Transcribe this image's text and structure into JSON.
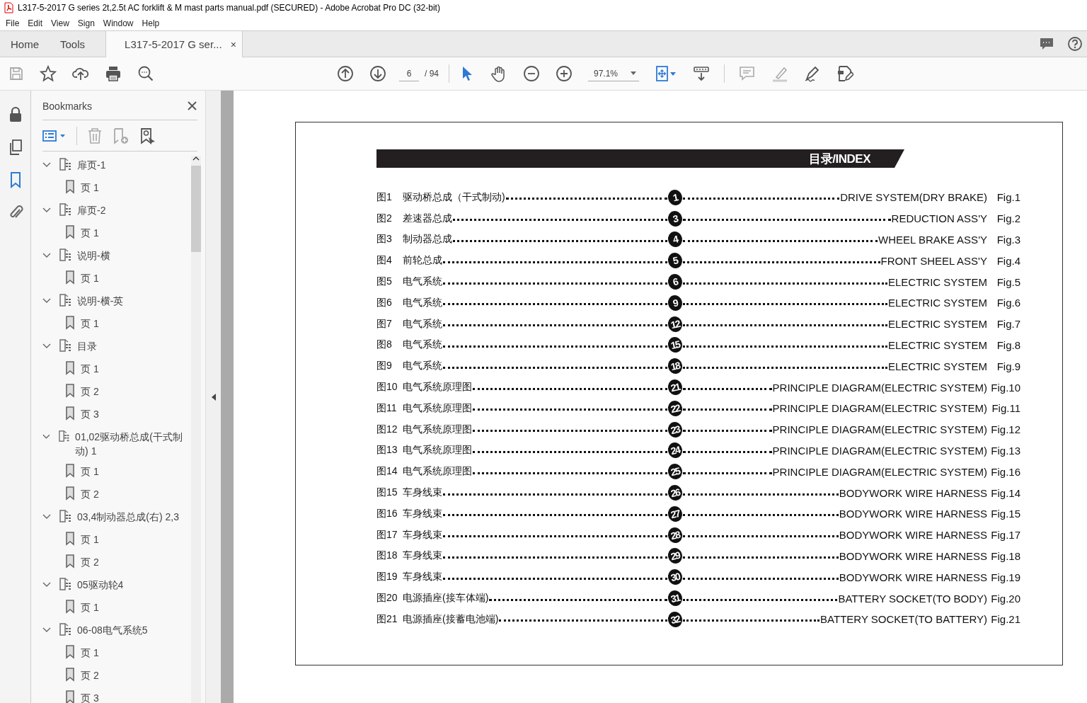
{
  "window": {
    "title": "L317-5-2017 G series 2t,2.5t AC forklift & M mast parts manual.pdf (SECURED) - Adobe Acrobat Pro DC (32-bit)"
  },
  "menu": [
    "File",
    "Edit",
    "View",
    "Sign",
    "Window",
    "Help"
  ],
  "tabs": [
    {
      "label": "Home",
      "selected": false
    },
    {
      "label": "Tools",
      "selected": false
    },
    {
      "label": "L317-5-2017 G ser...",
      "selected": true,
      "close": "×"
    }
  ],
  "toolbar": {
    "page": "6",
    "page_total": "/ 94",
    "zoom": "97.1%"
  },
  "side_tabs": [
    {
      "selected": false
    },
    {
      "selected": false
    },
    {
      "selected": true
    },
    {
      "selected": false
    }
  ],
  "bookmarks": {
    "title": "Bookmarks",
    "items": [
      {
        "label": "扉页-1",
        "expanded": true,
        "children": [
          {
            "label": "页 1"
          }
        ]
      },
      {
        "label": "扉页-2",
        "expanded": true,
        "children": [
          {
            "label": "页 1"
          }
        ]
      },
      {
        "label": "说明-横",
        "expanded": true,
        "children": [
          {
            "label": "页 1"
          }
        ]
      },
      {
        "label": "说明-横-英",
        "expanded": true,
        "children": [
          {
            "label": "页 1"
          }
        ]
      },
      {
        "label": "目录",
        "expanded": true,
        "children": [
          {
            "label": "页 1"
          },
          {
            "label": "页 2"
          },
          {
            "label": "页 3"
          }
        ]
      },
      {
        "label": "01,02驱动桥总成(干式制动) 1",
        "expanded": true,
        "children": [
          {
            "label": "页 1"
          },
          {
            "label": "页 2"
          }
        ]
      },
      {
        "label": "03,4制动器总成(右) 2,3",
        "expanded": true,
        "children": [
          {
            "label": "页 1"
          },
          {
            "label": "页 2"
          }
        ]
      },
      {
        "label": "05驱动轮4",
        "expanded": true,
        "children": [
          {
            "label": "页 1"
          }
        ]
      },
      {
        "label": "06-08电气系统5",
        "expanded": true,
        "children": [
          {
            "label": "页 1"
          },
          {
            "label": "页 2"
          },
          {
            "label": "页 3"
          }
        ]
      }
    ]
  },
  "document": {
    "heading": "目录/INDEX",
    "rows": [
      {
        "fig": "图1",
        "cn": "驱动桥总成（干式制动)",
        "page": "1",
        "en": "DRIVE SYSTEM(DRY BRAKE)",
        "ref": "Fig.1"
      },
      {
        "fig": "图2",
        "cn": "差速器总成",
        "page": "3",
        "en": "REDUCTION ASS'Y",
        "ref": "Fig.2"
      },
      {
        "fig": "图3",
        "cn": "制动器总成",
        "page": "4",
        "en": "WHEEL BRAKE ASS'Y",
        "ref": "Fig.3"
      },
      {
        "fig": "图4",
        "cn": "前轮总成",
        "page": "5",
        "en": "FRONT SHEEL ASS'Y",
        "ref": "Fig.4"
      },
      {
        "fig": "图5",
        "cn": "电气系统",
        "page": "6",
        "en": "ELECTRIC SYSTEM",
        "ref": "Fig.5"
      },
      {
        "fig": "图6",
        "cn": "电气系统",
        "page": "9",
        "en": "ELECTRIC SYSTEM",
        "ref": "Fig.6"
      },
      {
        "fig": "图7",
        "cn": "电气系统",
        "page": "12",
        "en": "ELECTRIC SYSTEM",
        "ref": "Fig.7"
      },
      {
        "fig": "图8",
        "cn": "电气系统",
        "page": "15",
        "en": "ELECTRIC SYSTEM",
        "ref": "Fig.8"
      },
      {
        "fig": "图9",
        "cn": "电气系统",
        "page": "18",
        "en": "ELECTRIC SYSTEM",
        "ref": "Fig.9"
      },
      {
        "fig": "图10",
        "cn": "电气系统原理图",
        "page": "21",
        "en": "PRINCIPLE DIAGRAM(ELECTRIC SYSTEM)",
        "ref": "Fig.10"
      },
      {
        "fig": "图11",
        "cn": "电气系统原理图",
        "page": "22",
        "en": "PRINCIPLE DIAGRAM(ELECTRIC SYSTEM)",
        "ref": "Fig.11"
      },
      {
        "fig": "图12",
        "cn": "电气系统原理图",
        "page": "23",
        "en": "PRINCIPLE DIAGRAM(ELECTRIC SYSTEM)",
        "ref": "Fig.12"
      },
      {
        "fig": "图13",
        "cn": "电气系统原理图",
        "page": "24",
        "en": "PRINCIPLE DIAGRAM(ELECTRIC SYSTEM)",
        "ref": "Fig.13"
      },
      {
        "fig": "图14",
        "cn": "电气系统原理图",
        "page": "25",
        "en": "PRINCIPLE DIAGRAM(ELECTRIC SYSTEM)",
        "ref": "Fig.16"
      },
      {
        "fig": "图15",
        "cn": "车身线束",
        "page": "26",
        "en": "BODYWORK WIRE HARNESS",
        "ref": "Fig.14"
      },
      {
        "fig": "图16",
        "cn": "车身线束",
        "page": "27",
        "en": "BODYWORK WIRE HARNESS",
        "ref": "Fig.15"
      },
      {
        "fig": "图17",
        "cn": "车身线束",
        "page": "28",
        "en": "BODYWORK WIRE HARNESS",
        "ref": "Fig.17"
      },
      {
        "fig": "图18",
        "cn": "车身线束",
        "page": "29",
        "en": "BODYWORK WIRE HARNESS",
        "ref": "Fig.18"
      },
      {
        "fig": "图19",
        "cn": "车身线束",
        "page": "30",
        "en": "BODYWORK WIRE HARNESS",
        "ref": "Fig.19"
      },
      {
        "fig": "图20",
        "cn": "电源插座(接车体端)",
        "page": "31",
        "en": "BATTERY SOCKET(TO BODY)",
        "ref": "Fig.20"
      },
      {
        "fig": "图21",
        "cn": "电源插座(接蓄电池端)",
        "page": "32",
        "en": "BATTERY SOCKET(TO BATTERY)",
        "ref": "Fig.21"
      }
    ]
  }
}
